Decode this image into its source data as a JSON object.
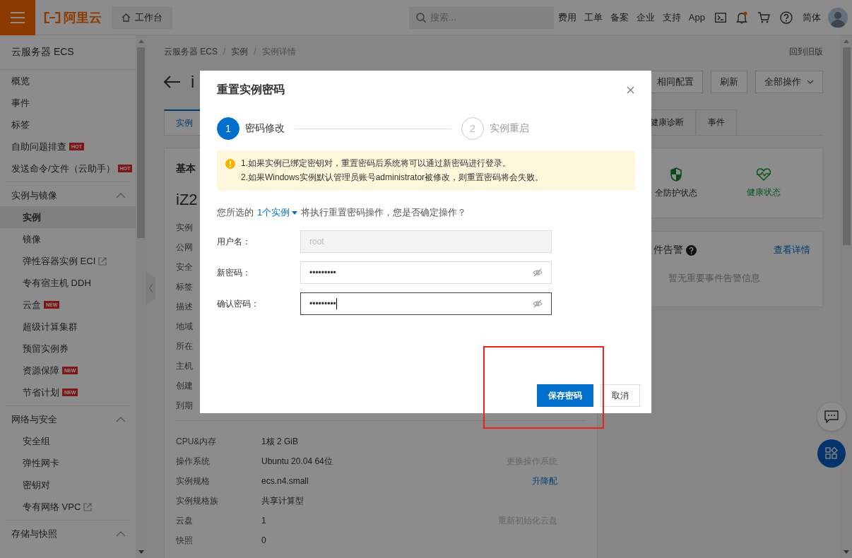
{
  "topbar": {
    "logo": "阿里云",
    "workbench": "工作台",
    "search": {
      "placeholder": "搜索..."
    },
    "links": [
      "费用",
      "工单",
      "备案",
      "企业",
      "支持",
      "App"
    ],
    "language": "简体"
  },
  "sidebar": {
    "title": "云服务器 ECS",
    "items": [
      {
        "label": "概览",
        "selected": false
      },
      {
        "label": "事件",
        "selected": false
      },
      {
        "label": "标签",
        "selected": false
      },
      {
        "label": "自助问题排查",
        "selected": false,
        "badge": "HOT"
      },
      {
        "label": "发送命令/文件（云助手）",
        "selected": false,
        "badge": "HOT"
      },
      {
        "label": "实例与镜像",
        "expanded": true,
        "children": [
          {
            "label": "实例",
            "selected": true
          },
          {
            "label": "镜像",
            "selected": false
          },
          {
            "label": "弹性容器实例 ECI",
            "selected": false,
            "external": true
          },
          {
            "label": "专有宿主机 DDH",
            "selected": false
          },
          {
            "label": "云盒",
            "selected": false,
            "badge": "NEW"
          },
          {
            "label": "超级计算集群",
            "selected": false
          },
          {
            "label": "预留实例券",
            "selected": false
          },
          {
            "label": "资源保障",
            "selected": false,
            "badge": "NEW"
          },
          {
            "label": "节省计划",
            "selected": false,
            "badge": "NEW"
          }
        ]
      },
      {
        "label": "网络与安全",
        "expanded": true,
        "children": [
          {
            "label": "安全组",
            "selected": false
          },
          {
            "label": "弹性网卡",
            "selected": false
          },
          {
            "label": "密钥对",
            "selected": false
          },
          {
            "label": "专有网络 VPC",
            "selected": false,
            "external": true
          }
        ]
      },
      {
        "label": "存储与快照",
        "expanded": true
      }
    ]
  },
  "breadcrumb": [
    {
      "label": "云服务器 ECS",
      "kind": "link"
    },
    {
      "label": "/",
      "kind": "separator"
    },
    {
      "label": "实例",
      "kind": "link"
    },
    {
      "label": "/",
      "kind": "separator"
    },
    {
      "label": "实例详情",
      "kind": "current"
    }
  ],
  "old_version_link": "回到旧版",
  "header": {
    "title": "i",
    "actions": [
      {
        "label": "相同配置",
        "dropdown": false
      },
      {
        "label": "刷新",
        "dropdown": false
      },
      {
        "label": "全部操作",
        "dropdown": true
      }
    ]
  },
  "tabs": [
    {
      "label": "实例",
      "selected": true
    },
    {
      "label": "健康诊断",
      "selected": false
    },
    {
      "label": "事件",
      "selected": false
    }
  ],
  "basic_card": {
    "title": "基本",
    "name": "iZ2",
    "labels": [
      "实例",
      "公网",
      "安全",
      "标签",
      "描述",
      "地域",
      "所在",
      "主机",
      "创建",
      "到期"
    ],
    "rows": [
      {
        "label": "CPU&内存",
        "value": "1核 2 GiB"
      },
      {
        "label": "操作系统",
        "value": "Ubuntu 20.04 64位",
        "action": {
          "label": "更换操作系统",
          "disabled": true
        }
      },
      {
        "label": "实例规格",
        "value": "ecs.n4.small",
        "action": {
          "label": "升降配",
          "disabled": false
        }
      },
      {
        "label": "实例规格族",
        "value": "共享计算型"
      },
      {
        "label": "云盘",
        "value": "1",
        "action": {
          "label": "重新初始化云盘",
          "disabled": true
        }
      },
      {
        "label": "快照",
        "value": "0"
      }
    ]
  },
  "status_card": {
    "items": [
      {
        "label": "全防护状态",
        "kind": "shield"
      },
      {
        "label": "健康状态",
        "kind": "heartbeat"
      }
    ]
  },
  "event_card": {
    "title": "件告警",
    "link": "查看详情",
    "empty": "暂无重要事件告警信息"
  },
  "dialog": {
    "title": "重置实例密码",
    "steps": [
      {
        "number": "1",
        "label": "密码修改",
        "selected": true
      },
      {
        "number": "2",
        "label": "实例重启",
        "selected": false
      }
    ],
    "notice": [
      "1.如果实例已绑定密钥对，重置密码后系统将可以通过新密码进行登录。",
      "2.如果Windows实例默认管理员账号administrator被修改，则重置密码将会失败。"
    ],
    "question": {
      "before": "您所选的",
      "link": "1个实例",
      "after": "将执行重置密码操作，您是否确定操作？"
    },
    "fields": [
      {
        "label": "用户名：",
        "value": "root",
        "kind": "text",
        "disabled": true,
        "focused": false
      },
      {
        "label": "新密码：",
        "value": "•••••••••",
        "kind": "password",
        "disabled": false,
        "focused": false
      },
      {
        "label": "确认密码：",
        "value": "•••••••••",
        "kind": "password",
        "disabled": false,
        "focused": true
      }
    ],
    "buttons": [
      {
        "label": "保存密码",
        "kind": "primary"
      },
      {
        "label": "取消",
        "kind": "default"
      }
    ]
  },
  "annotation": {
    "kind": "frame"
  }
}
